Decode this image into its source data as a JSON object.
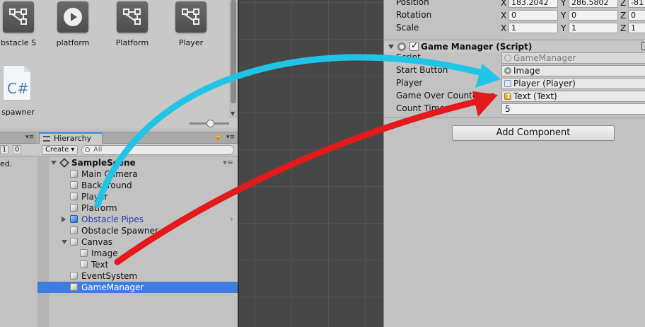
{
  "project": {
    "assets": [
      {
        "label": "bstacle S",
        "icon": "prefab-icon"
      },
      {
        "label": "platform",
        "icon": "audio-clip-icon"
      },
      {
        "label": "Platform",
        "icon": "prefab-icon"
      },
      {
        "label": "Player",
        "icon": "prefab-icon"
      },
      {
        "label": "spawner",
        "icon": "csharp-script-icon"
      }
    ],
    "cs_glyph": "C#"
  },
  "console": {
    "counts": [
      "1",
      "0"
    ],
    "message": "ed."
  },
  "hierarchy": {
    "tab_label": "Hierarchy",
    "create_label": "Create ▾",
    "search_placeholder": "All",
    "scene_name": "SampleScene",
    "items": [
      {
        "label": "Main Camera"
      },
      {
        "label": "Background"
      },
      {
        "label": "Player"
      },
      {
        "label": "Platform"
      },
      {
        "label": "Obstacle Pipes"
      },
      {
        "label": "Obstacle Spawner"
      },
      {
        "label": "Canvas"
      },
      {
        "label": "Image"
      },
      {
        "label": "Text"
      },
      {
        "label": "EventSystem"
      },
      {
        "label": "GameManager"
      }
    ]
  },
  "inspector": {
    "transform": {
      "position": {
        "label": "Position",
        "x": "183.2042",
        "y": "286.5802",
        "z": "-81"
      },
      "rotation": {
        "label": "Rotation",
        "x": "0",
        "y": "0",
        "z": "0"
      },
      "scale": {
        "label": "Scale",
        "x": "1",
        "y": "1",
        "z": "1"
      }
    },
    "axes": {
      "x": "X",
      "y": "Y",
      "z": "Z"
    },
    "component": {
      "title": "Game Manager (Script)",
      "fields": [
        {
          "label": "Script",
          "value": "GameManager"
        },
        {
          "label": "Start Button",
          "value": "Image"
        },
        {
          "label": "Player",
          "value": "Player (Player)"
        },
        {
          "label": "Game Over Countdown",
          "value": "Text (Text)"
        },
        {
          "label": "Count Timer",
          "value": "5"
        }
      ]
    },
    "add_component_label": "Add Component"
  },
  "colors": {
    "arrow_cyan": "#21c4e6",
    "arrow_red": "#e3191b",
    "selection": "#3e7ce0",
    "prefab_text": "#1a3fa8"
  }
}
